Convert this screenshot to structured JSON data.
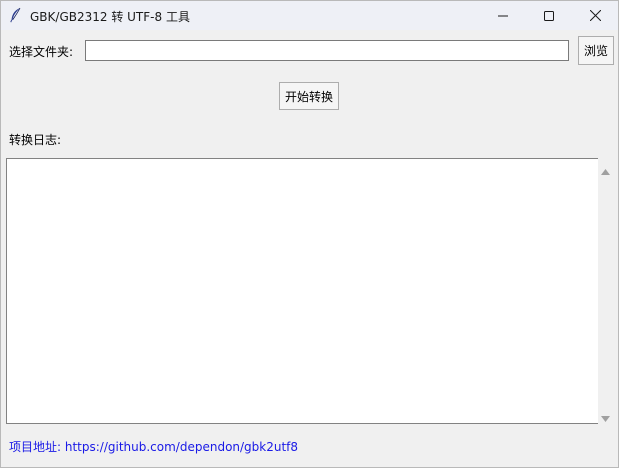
{
  "window": {
    "title": "GBK/GB2312 转 UTF-8 工具",
    "icon": "feather-icon",
    "controls": [
      "minimize-icon",
      "maximize-icon",
      "close-icon"
    ]
  },
  "folder": {
    "label": "选择文件夹:",
    "value": "",
    "placeholder": "",
    "browse_label": "浏览"
  },
  "actions": {
    "start_label": "开始转换"
  },
  "log": {
    "label": "转换日志:",
    "content": ""
  },
  "footer": {
    "link_text": "项目地址: https://github.com/dependon/gbk2utf8",
    "link_color": "#1a1ae6"
  }
}
